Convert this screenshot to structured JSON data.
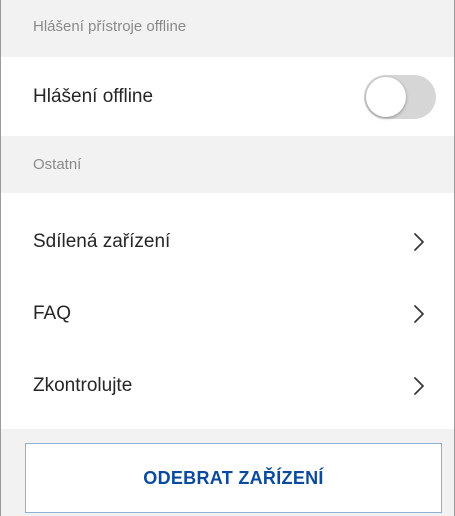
{
  "sections": {
    "offline_header": "Hlášení přístroje offline",
    "other_header": "Ostatní"
  },
  "offline_toggle": {
    "label": "Hlášení offline",
    "enabled": false,
    "track_color": "#d6d6d6"
  },
  "other_items": [
    {
      "label": "Sdílená zařízení",
      "icon": "chevron-right-icon"
    },
    {
      "label": "FAQ",
      "icon": "chevron-right-icon"
    },
    {
      "label": "Zkontrolujte",
      "icon": "chevron-right-icon"
    }
  ],
  "remove_button": {
    "label": "ODEBRAT ZAŘÍZENÍ",
    "color": "#0b4a9e",
    "border_color": "#8db1d6"
  }
}
